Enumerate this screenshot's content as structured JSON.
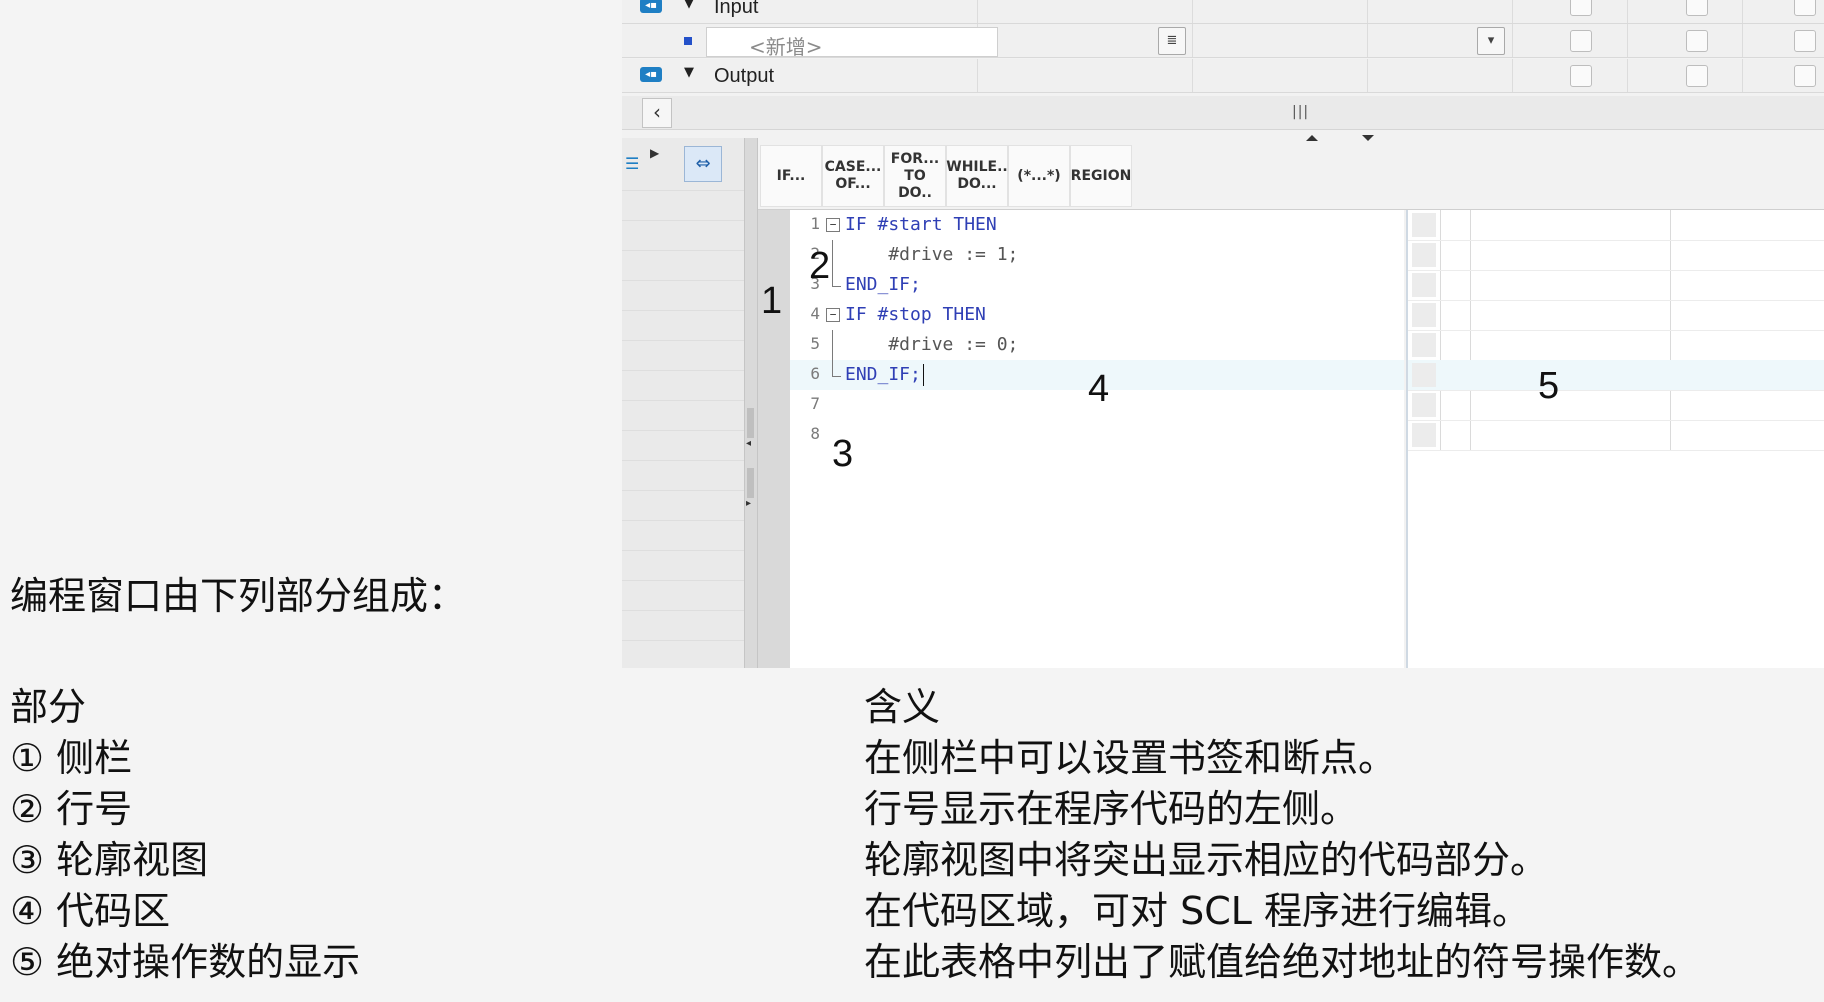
{
  "interface": {
    "input_label": "Input",
    "output_label": "Output",
    "new_placeholder": "<新增>",
    "section_icon": "interface-section-icon",
    "expand_icon": "triangle-down-icon"
  },
  "toolbar": {
    "buttons": [
      "IF...",
      "CASE...\nOF...",
      "FOR...\nTO DO..",
      "WHILE..\nDO...",
      "(*...*)",
      "REGION"
    ]
  },
  "code": {
    "lines": [
      {
        "n": "1",
        "text": "IF #start THEN"
      },
      {
        "n": "2",
        "text": "    #drive := 1;"
      },
      {
        "n": "3",
        "text": "END_IF;"
      },
      {
        "n": "4",
        "text": "IF #stop THEN"
      },
      {
        "n": "5",
        "text": "    #drive := 0;"
      },
      {
        "n": "6",
        "text": "END_IF;"
      },
      {
        "n": "7",
        "text": ""
      },
      {
        "n": "8",
        "text": ""
      }
    ]
  },
  "markers": {
    "m1": "1",
    "m2": "2",
    "m3": "3",
    "m4": "4",
    "m5": "5"
  },
  "legend": {
    "intro": "编程窗口由下列部分组成：",
    "col_part": "部分",
    "col_meaning": "含义",
    "rows": [
      {
        "part": "① 侧栏",
        "meaning": "在侧栏中可以设置书签和断点。"
      },
      {
        "part": "② 行号",
        "meaning": "行号显示在程序代码的左侧。"
      },
      {
        "part": "③ 轮廓视图",
        "meaning": "轮廓视图中将突出显示相应的代码部分。"
      },
      {
        "part": "④ 代码区",
        "meaning": "在代码区域，可对 SCL 程序进行编辑。"
      },
      {
        "part": "⑤ 绝对操作数的显示",
        "meaning": "在此表格中列出了赋值给绝对地址的符号操作数。"
      }
    ]
  }
}
